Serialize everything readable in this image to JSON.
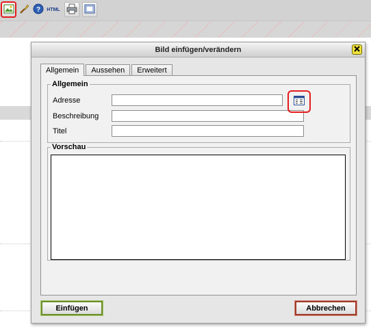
{
  "toolbar": {
    "icons": [
      "insert-image-icon",
      "clean-brush-icon",
      "help-icon",
      "html-source-icon",
      "print-icon",
      "fullscreen-icon"
    ],
    "html_label": "HTML"
  },
  "dialog": {
    "title": "Bild einfügen/verändern",
    "tabs": [
      {
        "label": "Allgemein",
        "active": true
      },
      {
        "label": "Aussehen",
        "active": false
      },
      {
        "label": "Erweitert",
        "active": false
      }
    ],
    "general": {
      "legend": "Allgemein",
      "fields": {
        "address": {
          "label": "Adresse",
          "value": ""
        },
        "description": {
          "label": "Beschreibung",
          "value": ""
        },
        "title": {
          "label": "Titel",
          "value": ""
        }
      },
      "browse_icon": "browse-file-list-icon"
    },
    "preview": {
      "legend": "Vorschau"
    },
    "buttons": {
      "insert": "Einfügen",
      "cancel": "Abbrechen"
    }
  },
  "colors": {
    "highlight": "#e21b1b",
    "close_button": "#f1e23a",
    "insert_border": "#6b8f2a",
    "cancel_border": "#a03a2a"
  }
}
